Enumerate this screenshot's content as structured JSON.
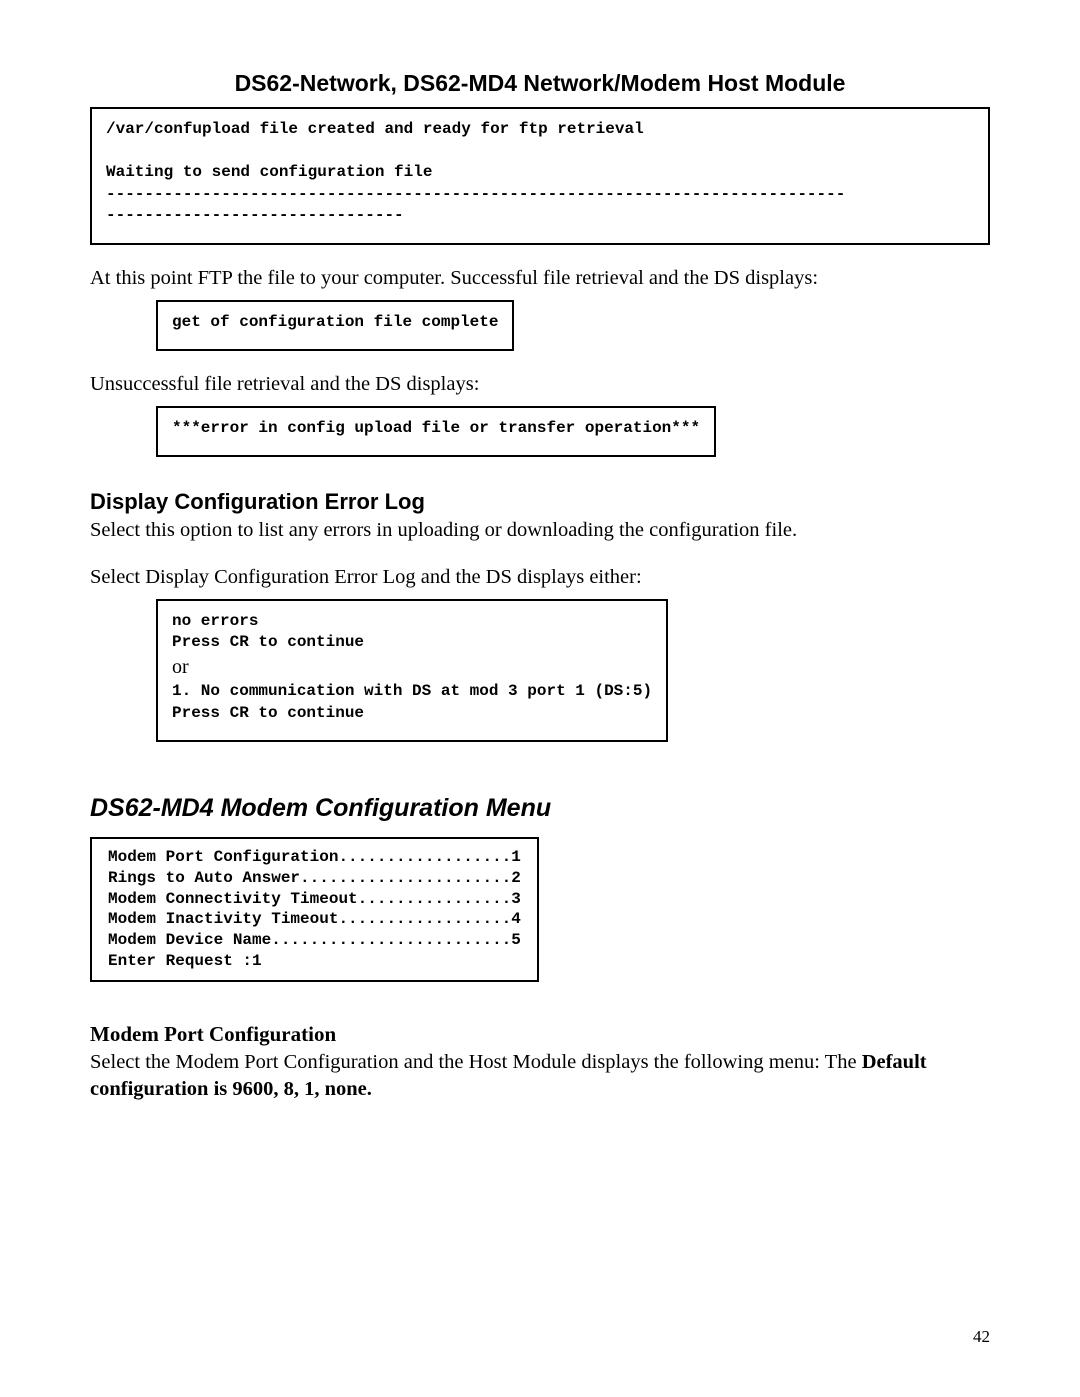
{
  "header": {
    "title": "DS62-Network, DS62-MD4 Network/Modem Host Module"
  },
  "terminal1": {
    "line1": "/var/confupload file created and ready for ftp retrieval",
    "blank": "",
    "line2": "Waiting to send configuration file",
    "dashline1": "-----------------------------------------------------------------------------",
    "dashline2": "-------------------------------"
  },
  "para1": "At this point FTP the file to your computer. Successful file retrieval and the DS displays:",
  "terminal2": {
    "line1": "get of configuration file complete"
  },
  "para2": "Unsuccessful file retrieval and the DS displays:",
  "terminal3": {
    "line1": "***error in config upload file or transfer operation***"
  },
  "section1": {
    "heading": "Display Configuration Error Log",
    "p1": "Select this option to list any errors in uploading or downloading the configuration file.",
    "p2": "Select Display Configuration Error Log and the DS displays either:"
  },
  "terminal4": {
    "line1": "no errors",
    "line2": "Press CR to continue",
    "or": "or",
    "line3": "1. No communication with DS at mod 3 port 1 (DS:5)",
    "line4": "Press CR to continue"
  },
  "section2": {
    "heading": "DS62-MD4 Modem Configuration Menu"
  },
  "menu": {
    "l1": "Modem Port Configuration..................1",
    "l2": "Rings to Auto Answer......................2",
    "l3": "Modem Connectivity Timeout................3",
    "l4": "Modem Inactivity Timeout..................4",
    "l5": "Modem Device Name.........................5",
    "l6": "Enter Request :1"
  },
  "section3": {
    "heading": "Modem Port Configuration",
    "p1_part1": "Select the Modem Port Configuration and the Host Module displays the following menu: The ",
    "p1_bold": "Default configuration is 9600, 8, 1, none."
  },
  "page_number": "42"
}
